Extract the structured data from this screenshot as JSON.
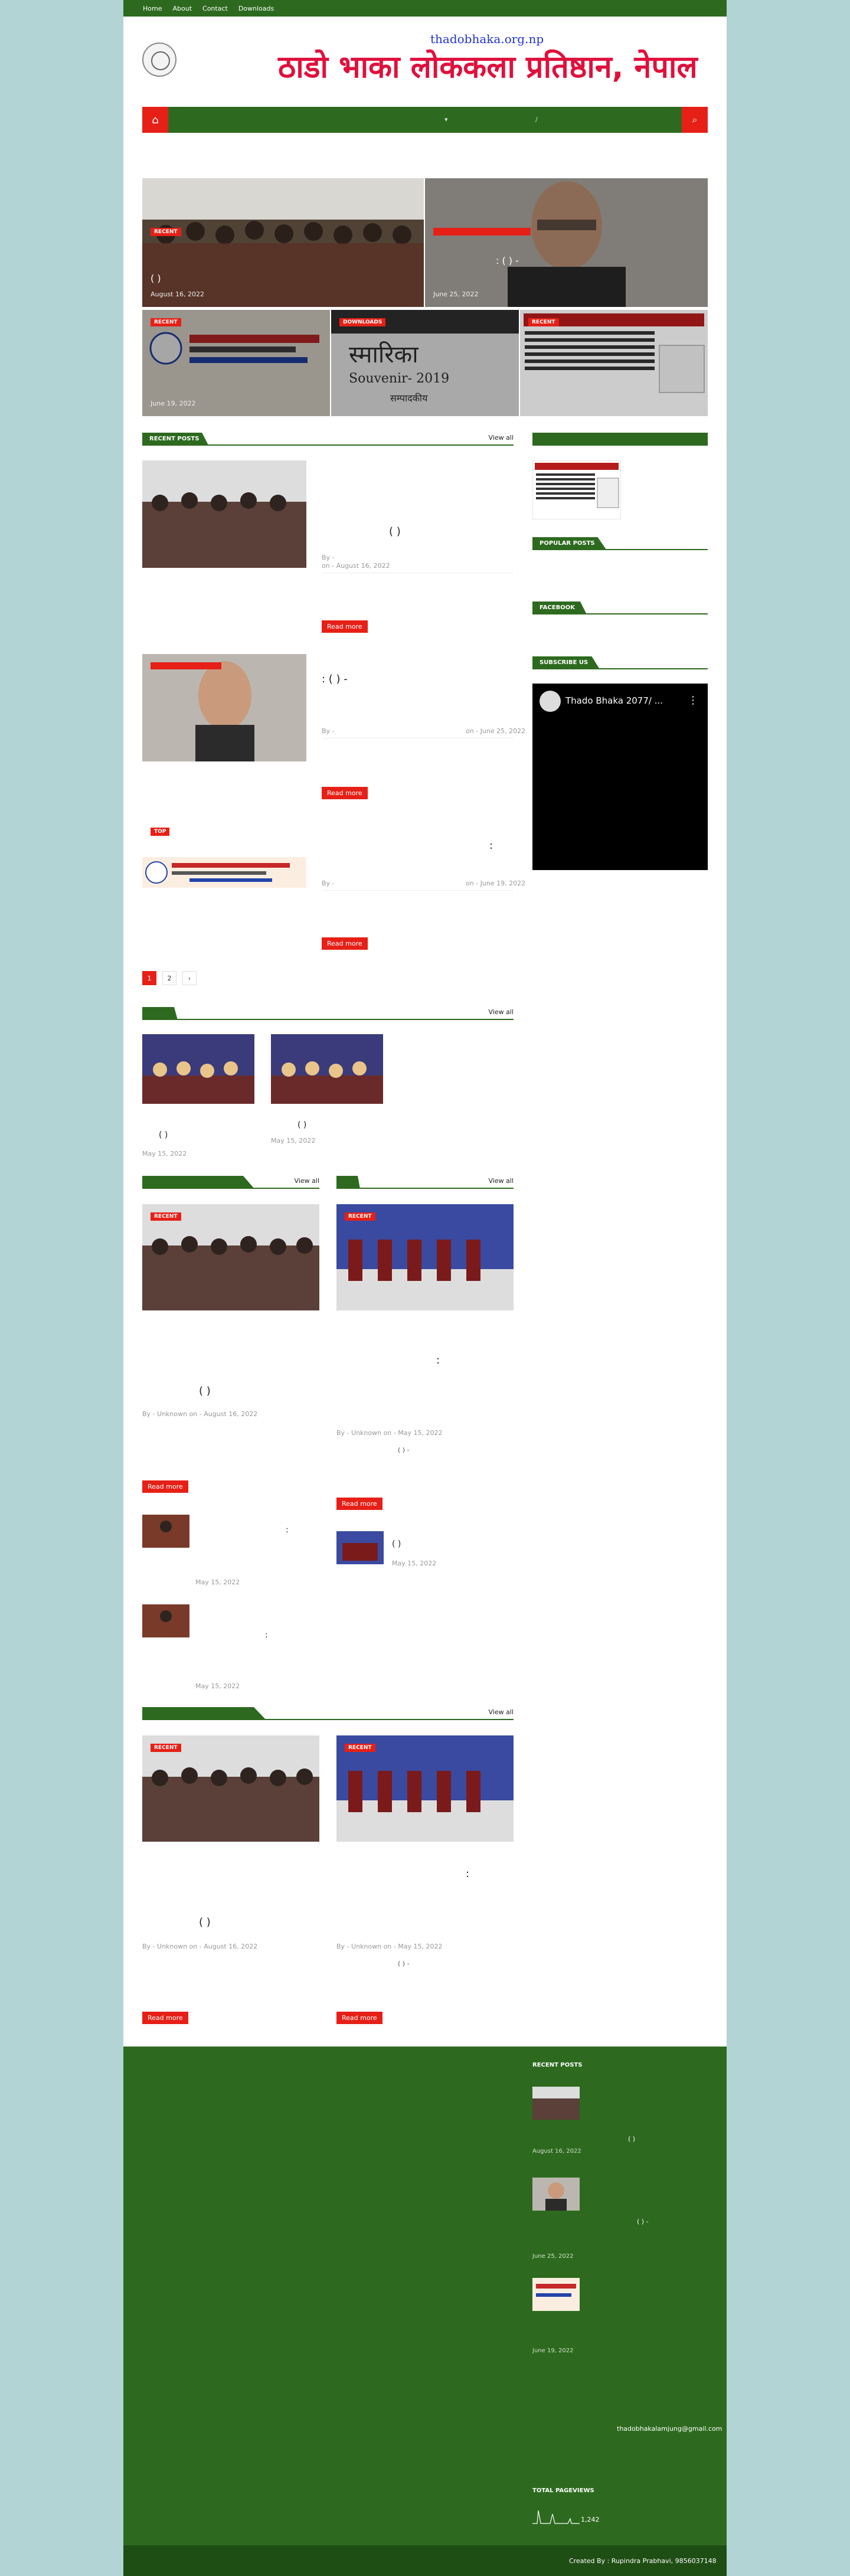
{
  "topbar": {
    "links": [
      "Home",
      "About",
      "Contact",
      "Downloads"
    ]
  },
  "header": {
    "url_text": "thadobhaka.org.np",
    "org_name": "ठाडो भाका लोककला प्रतिष्ठान, नेपाल"
  },
  "featured": [
    {
      "badge": "RECENT",
      "title": "(                    )",
      "date": "August 16, 2022"
    },
    {
      "badge": "",
      "title": ":   (              ) -",
      "date": "June 25, 2022"
    },
    {
      "badge": "RECENT",
      "title": "",
      "date": "June 19, 2022"
    },
    {
      "badge": "DOWNLOADS",
      "title": "",
      "date": ""
    },
    {
      "badge": "RECENT",
      "title": "",
      "date": ""
    }
  ],
  "souvenir": {
    "line1": "स्मारिका",
    "line2": "Souvenir- 2019",
    "line3": "सम्पादकीय"
  },
  "recent_posts": {
    "heading": "RECENT POSTS",
    "view_all": "View all",
    "items": [
      {
        "title": "(                    )",
        "by": "By -",
        "date": "on - August 16, 2022",
        "read_more": "Read more"
      },
      {
        "title": ":   (              ) -",
        "by": "By -",
        "date": "on - June 25, 2022",
        "read_more": "Read more"
      },
      {
        "badge": "TOP",
        "title": ":",
        "by": "By -",
        "date": "on - June 19, 2022",
        "read_more": "Read more"
      }
    ]
  },
  "pagination": [
    "1",
    "2",
    "›"
  ],
  "sidebar": {
    "popular": "POPULAR POSTS",
    "facebook": "FACEBOOK",
    "subscribe": "SUBSCRIBE US",
    "video_title": "Thado Bhaka 2077/ ..."
  },
  "sec2": {
    "view_all": "View all",
    "items": [
      {
        "title": "(              )",
        "date": "May 15, 2022"
      },
      {
        "title": "(              )",
        "date": "May 15, 2022"
      }
    ]
  },
  "sec3": {
    "left": {
      "badge": "RECENT",
      "title": "(                    )",
      "meta": "By - Unknown on - August 16, 2022",
      "read_more": "Read more",
      "small": [
        {
          "title": ":",
          "date": "May 15, 2022"
        },
        {
          "title": ":",
          "date": "May 15, 2022"
        }
      ]
    },
    "right": {
      "badge": "RECENT",
      "title": ":",
      "meta": "By - Unknown on - May 15, 2022",
      "excerpt": "(        ) -",
      "read_more": "Read more",
      "small": [
        {
          "title": "(        )",
          "date": "May 15, 2022"
        }
      ]
    },
    "view_all": "View all"
  },
  "sec4": {
    "view_all": "View all",
    "left": {
      "badge": "RECENT",
      "title": "(                    )",
      "meta": "By - Unknown on - August 16, 2022",
      "read_more": "Read more"
    },
    "right": {
      "badge": "RECENT",
      "title": ":",
      "meta": "By - Unknown on - May 15, 2022",
      "excerpt": "(        ) -",
      "read_more": "Read more"
    }
  },
  "footer": {
    "recent_heading": "RECENT POSTS",
    "recent": [
      {
        "title": "(                    )",
        "date": "August 16, 2022"
      },
      {
        "title": "(          ) -",
        "date": "June 25, 2022"
      },
      {
        "title": "",
        "date": "June 19, 2022"
      }
    ],
    "email": "thadobhakalamjung@gmail.com",
    "pageviews_heading": "TOTAL PAGEVIEWS",
    "pageviews": "1,242",
    "credit": "Created By : Rupindra Prabhavi, 9856037148"
  },
  "colors": {
    "green": "#2d6a1f",
    "red": "#e62017"
  }
}
